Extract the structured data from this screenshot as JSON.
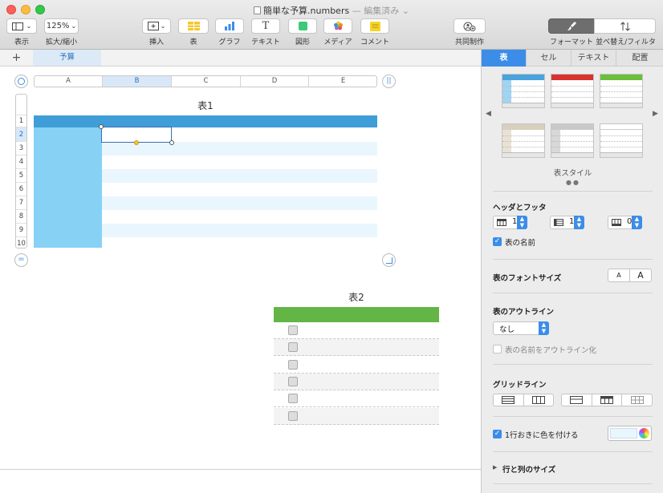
{
  "window": {
    "title": "簡単な予算.numbers",
    "title_status": "— 編集済み",
    "traffic_colors": [
      "#fc605c",
      "#fdbc40",
      "#34c84a"
    ]
  },
  "toolbar": {
    "view_label": "表示",
    "zoom_value": "125%",
    "zoom_label": "拡大/縮小",
    "insert_label": "挿入",
    "table_label": "表",
    "chart_label": "グラフ",
    "text_label": "テキスト",
    "shape_label": "図形",
    "media_label": "メディア",
    "comment_label": "コメント",
    "collab_label": "共同制作",
    "format_label": "フォーマット",
    "sort_label": "並べ替え/フィルタ"
  },
  "sheet_tabs": {
    "add_label": "+",
    "tabs": [
      "予算"
    ]
  },
  "table1": {
    "name": "表1",
    "columns": [
      "A",
      "B",
      "C",
      "D",
      "E"
    ],
    "rows": [
      "1",
      "2",
      "3",
      "4",
      "5",
      "6",
      "7",
      "8",
      "9",
      "10"
    ],
    "header_color": "#3f9ed8",
    "header_col_color": "#87d1f5",
    "band_color": "#e9f6fd"
  },
  "table2": {
    "name": "表2",
    "header_color": "#63b546",
    "checkbox_rows": 6
  },
  "sidebar": {
    "tabs": [
      "表",
      "セル",
      "テキスト",
      "配置"
    ],
    "active_tab": "表",
    "style_label": "表スタイル",
    "header_footer_label": "ヘッダとフッタ",
    "header_rows": "1",
    "header_cols": "1",
    "footer_rows": "0",
    "table_name_label": "表の名前",
    "font_size_label": "表のフォントサイズ",
    "font_small": "A",
    "font_large": "A",
    "outline_label": "表のアウトライン",
    "outline_value": "なし",
    "outline_name_label": "表の名前をアウトライン化",
    "gridlines_label": "グリッドライン",
    "alternate_label": "1行おきに色を付ける",
    "alternate_color": "#e8f6fe",
    "row_col_size_label": "行と列のサイズ"
  }
}
